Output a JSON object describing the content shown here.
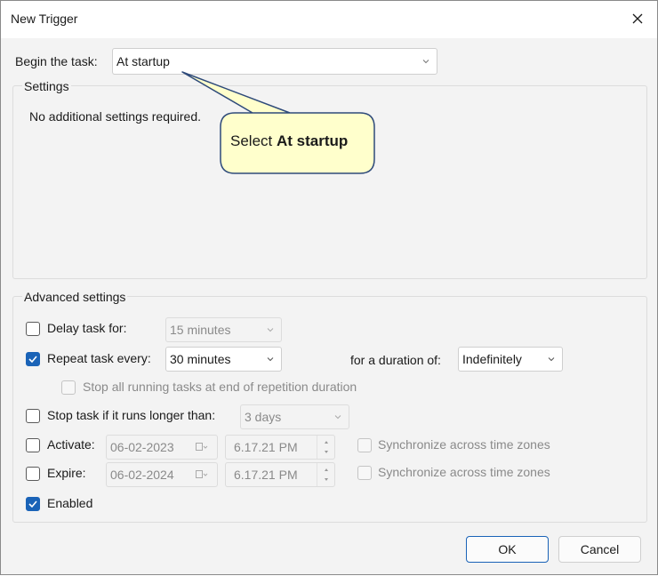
{
  "window": {
    "title": "New Trigger"
  },
  "begin": {
    "label": "Begin the task:",
    "value": "At startup"
  },
  "settings": {
    "label": "Settings",
    "message": "No additional settings required."
  },
  "callout": {
    "prefix": "Select ",
    "emphasis": "At startup"
  },
  "advanced": {
    "label": "Advanced settings",
    "delay": {
      "label": "Delay task for:",
      "value": "15 minutes",
      "checked": false
    },
    "repeat": {
      "label": "Repeat task every:",
      "value": "30 minutes",
      "checked": true,
      "duration_label": "for a duration of:",
      "duration_value": "Indefinitely"
    },
    "stop_repetition": {
      "label": "Stop all running tasks at end of repetition duration",
      "checked": false
    },
    "stop_longer": {
      "label": "Stop task if it runs longer than:",
      "value": "3 days",
      "checked": false
    },
    "activate": {
      "label": "Activate:",
      "date": "06-02-2023",
      "time": "6.17.21 PM",
      "checked": false,
      "sync_label": "Synchronize across time zones"
    },
    "expire": {
      "label": "Expire:",
      "date": "06-02-2024",
      "time": "6.17.21 PM",
      "checked": false,
      "sync_label": "Synchronize across time zones"
    },
    "enabled": {
      "label": "Enabled",
      "checked": true
    }
  },
  "buttons": {
    "ok": "OK",
    "cancel": "Cancel"
  },
  "colors": {
    "accent": "#1a63b7",
    "callout_fill": "#ffffcc",
    "callout_border": "#2e4a7a"
  }
}
